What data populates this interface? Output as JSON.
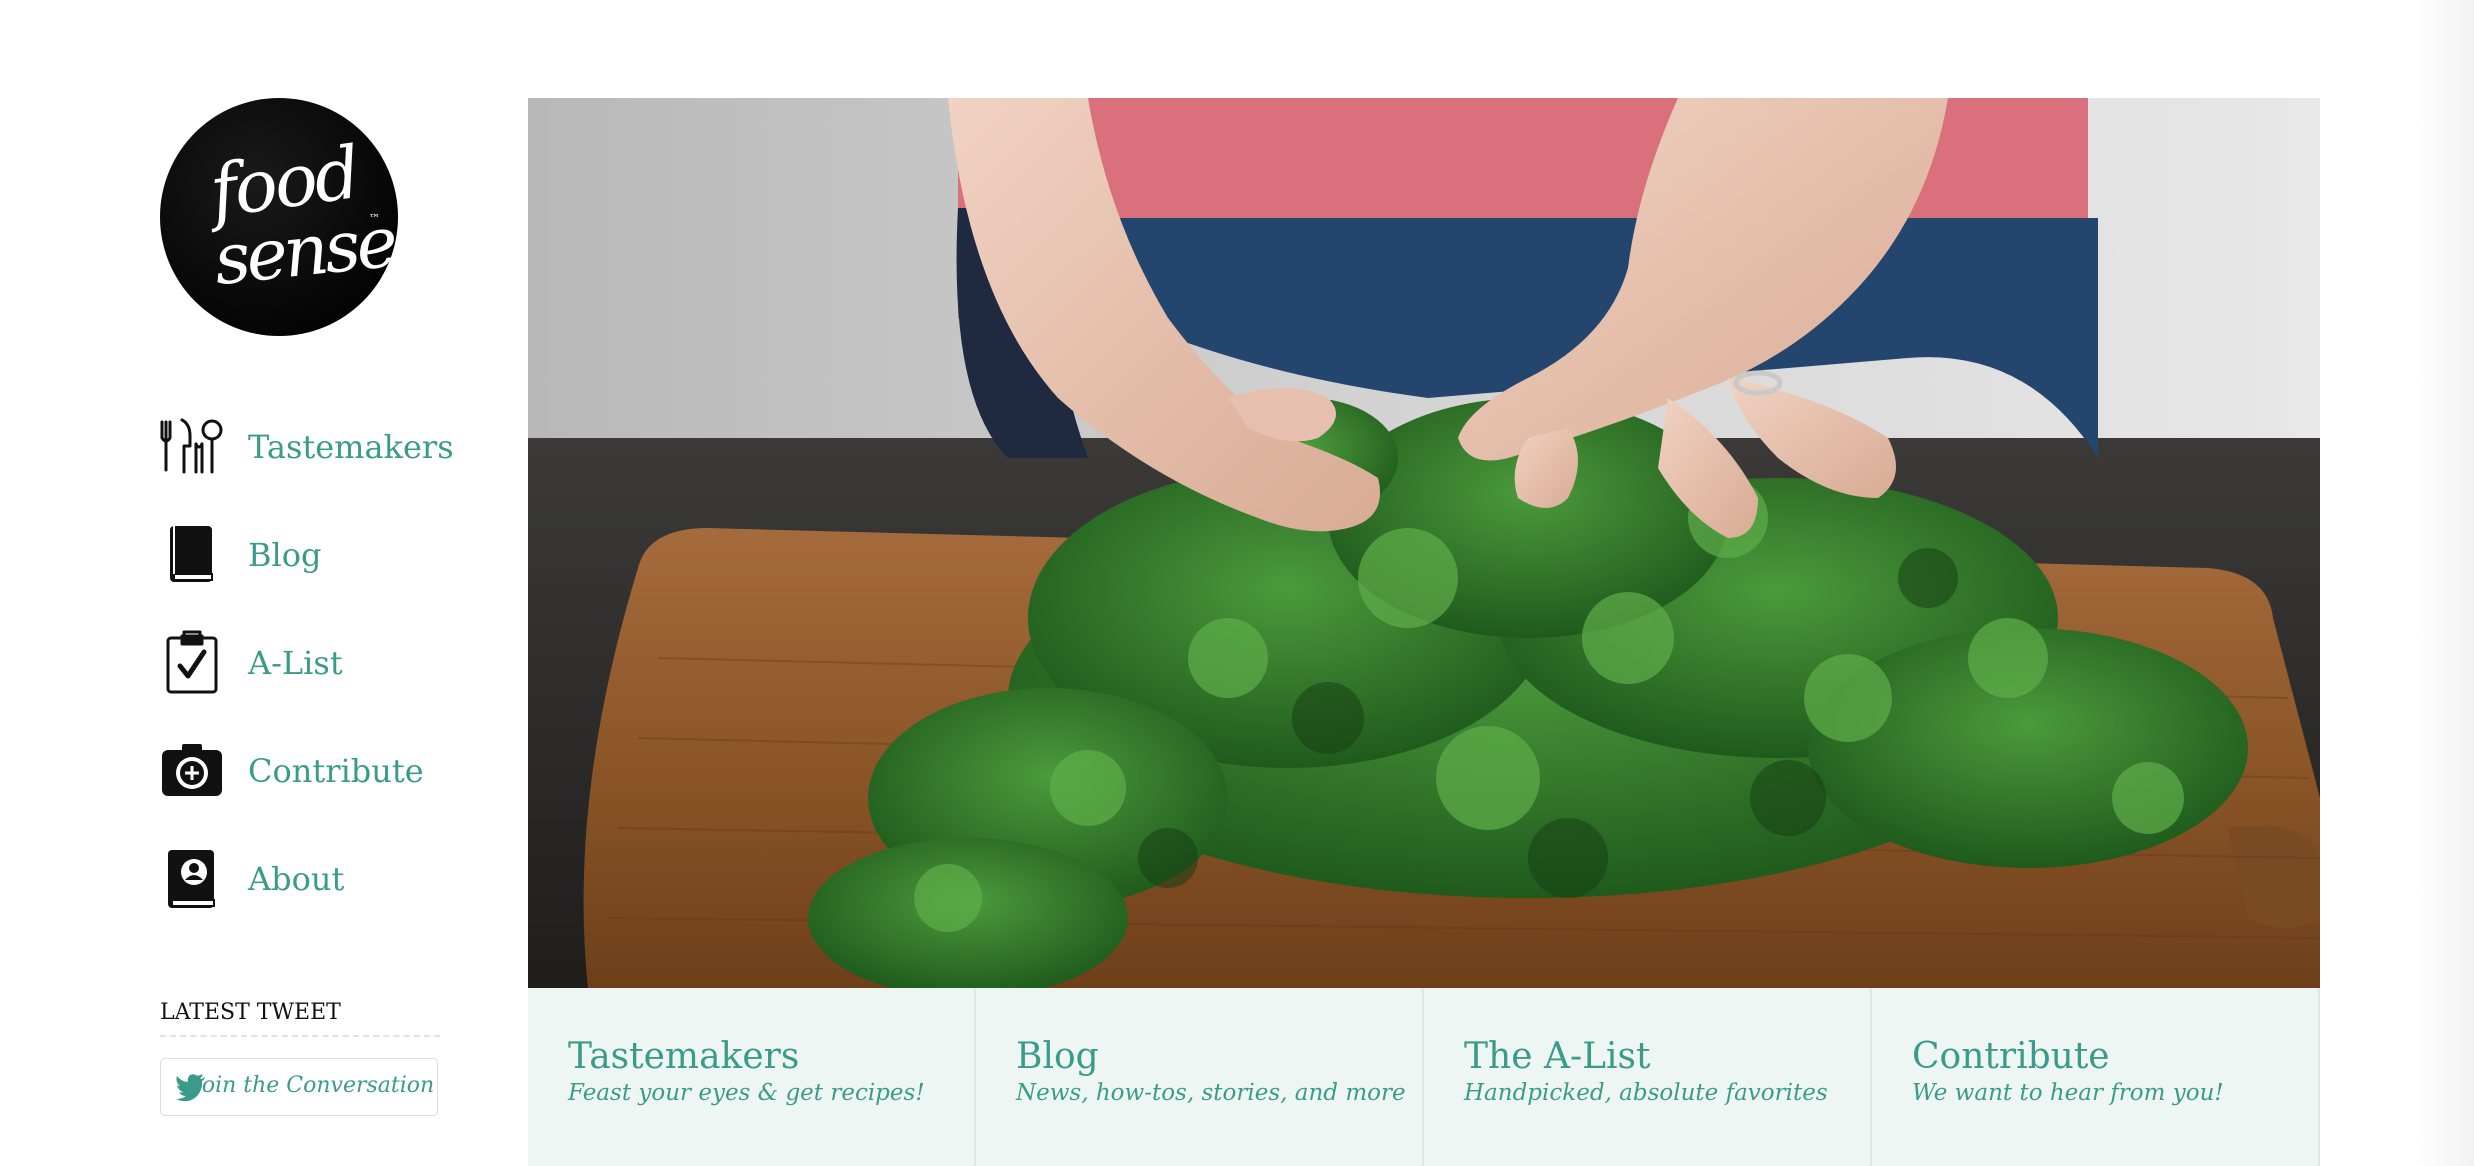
{
  "brand": {
    "logo_line1": "food",
    "logo_line2": "sense",
    "logo_mark": "™"
  },
  "sidebar": {
    "items": [
      {
        "label": "Tastemakers",
        "icon": "utensils-icon"
      },
      {
        "label": "Blog",
        "icon": "book-icon"
      },
      {
        "label": "A-List",
        "icon": "clipboard-check-icon"
      },
      {
        "label": "Contribute",
        "icon": "camera-plus-icon"
      },
      {
        "label": "About",
        "icon": "profile-book-icon"
      }
    ],
    "tweet_heading": "LATEST TWEET",
    "tweet_button": "Join the Conversation",
    "tweet_icon": "twitter-bird-icon"
  },
  "hero": {
    "image": "hands picking fresh parsley on a wooden cutting board"
  },
  "tiles": [
    {
      "title": "Tastemakers",
      "subtitle": "Feast your eyes & get recipes!"
    },
    {
      "title": "Blog",
      "subtitle": "News, how-tos, stories, and more"
    },
    {
      "title": "The A-List",
      "subtitle": "Handpicked, absolute favorites"
    },
    {
      "title": "Contribute",
      "subtitle": "We want to hear from you!"
    }
  ],
  "colors": {
    "accent": "#3a9b8a",
    "tile_bg": "#eef6f4",
    "text_dark": "#111111"
  }
}
